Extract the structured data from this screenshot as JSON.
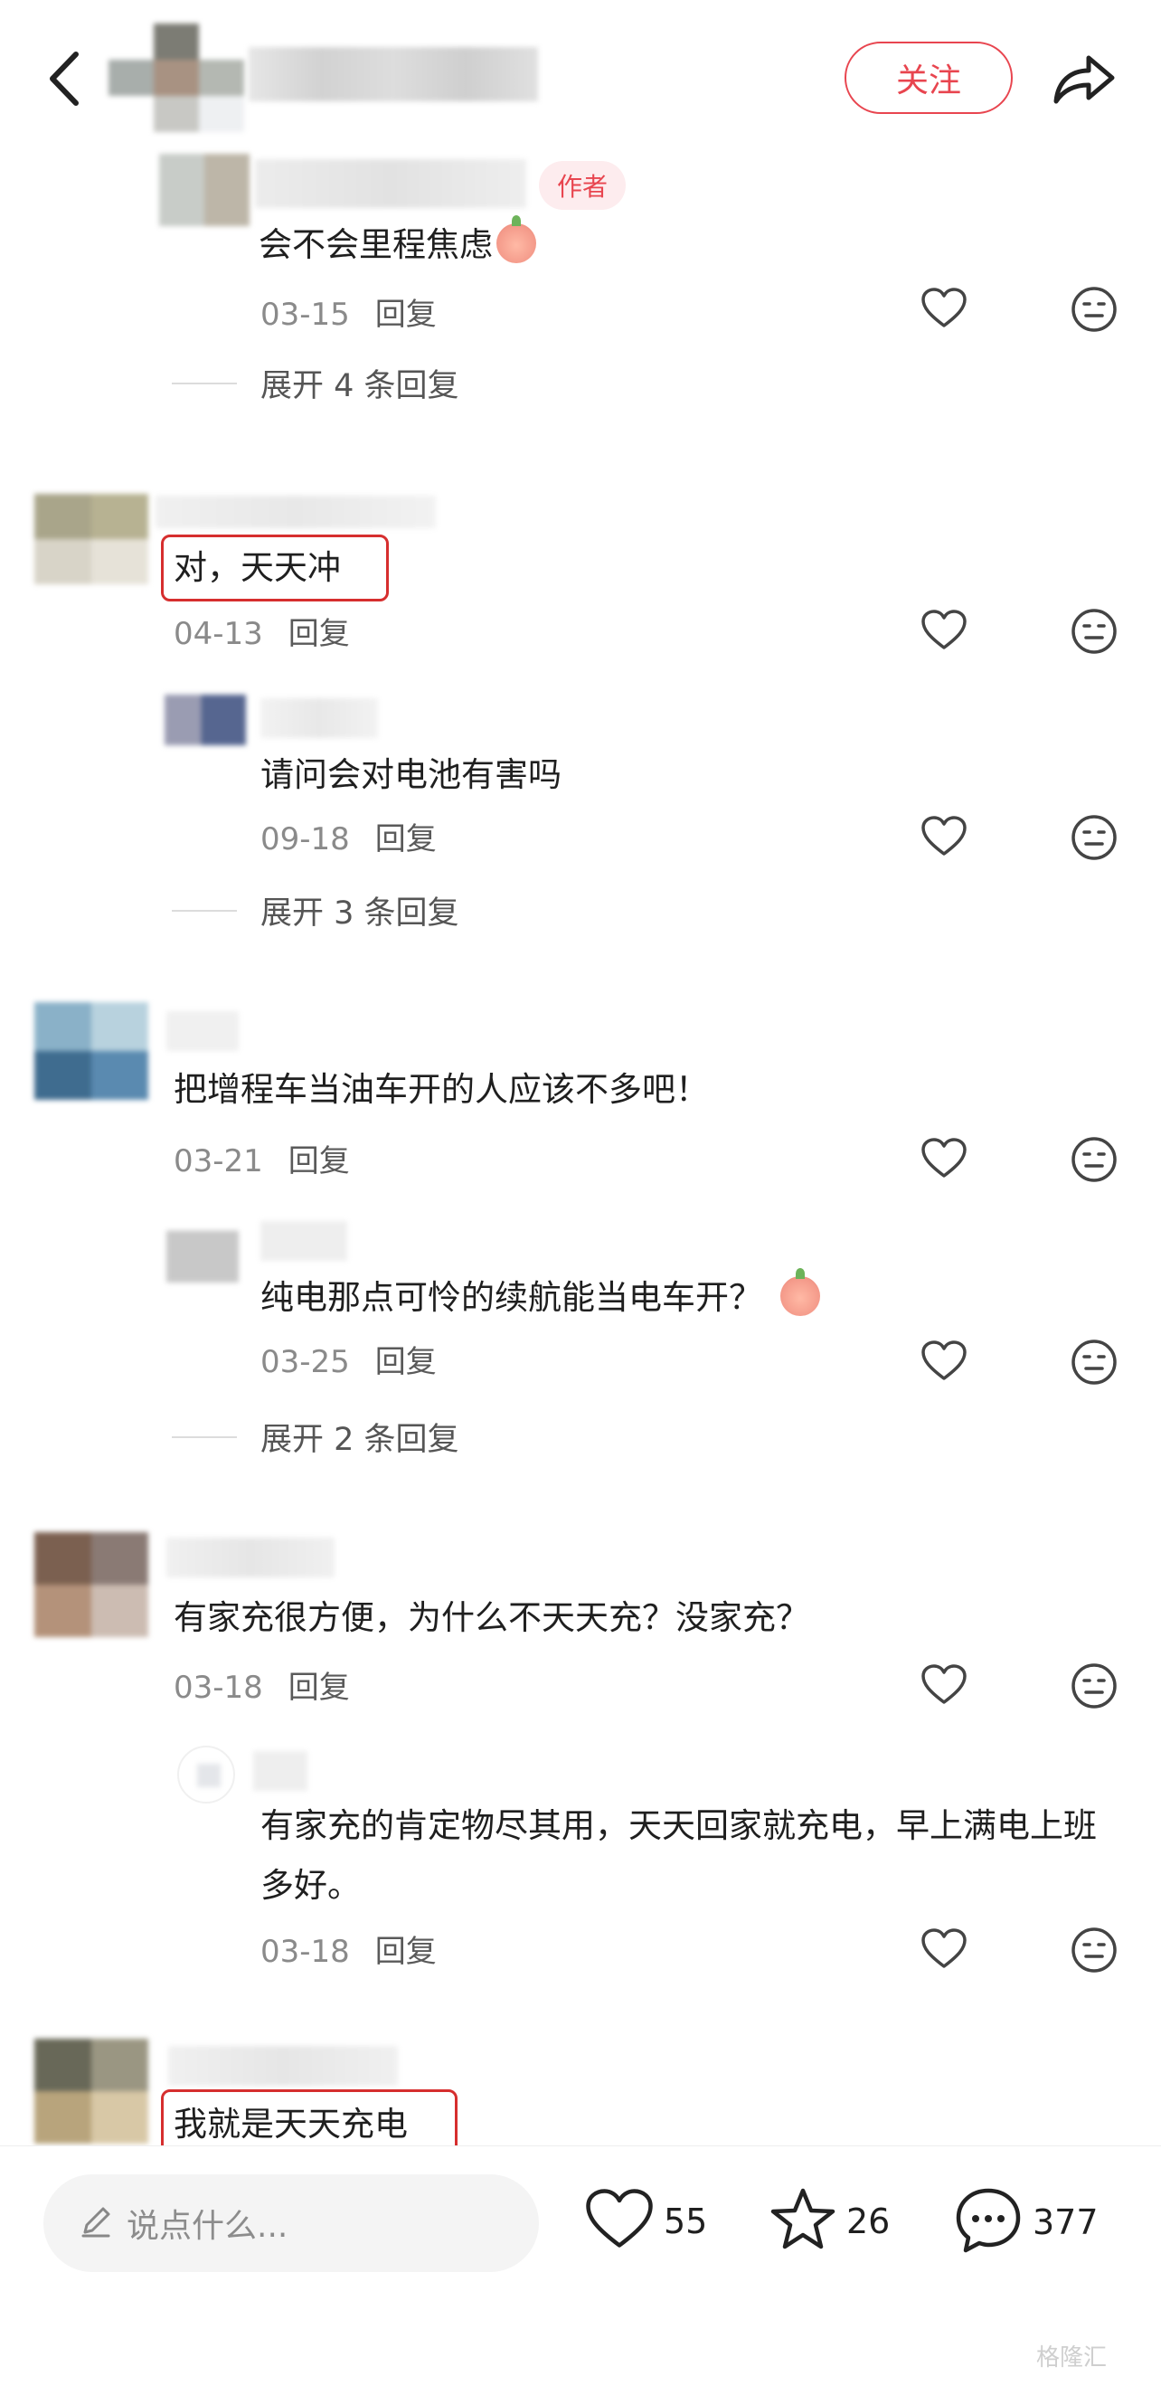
{
  "header": {
    "follow_label": "关注"
  },
  "comments": [
    {
      "author_tag": "作者",
      "text": "会不会里程焦虑",
      "date": "03-15",
      "reply": "回复",
      "expand": "展开 4 条回复"
    },
    {
      "text": "对，天天冲",
      "date": "04-13",
      "reply": "回复",
      "subreply": {
        "text": "请问会对电池有害吗",
        "date": "09-18",
        "reply": "回复"
      },
      "expand": "展开 3 条回复"
    },
    {
      "text": "把增程车当油车开的人应该不多吧！",
      "date": "03-21",
      "reply": "回复",
      "subreply": {
        "text": "纯电那点可怜的续航能当电车开？",
        "date": "03-25",
        "reply": "回复"
      },
      "expand": "展开 2 条回复"
    },
    {
      "text": "有家充很方便，为什么不天天充？没家充？",
      "date": "03-18",
      "reply": "回复",
      "subreply": {
        "text": "有家充的肯定物尽其用，天天回家就充电，早上满电上班多好。",
        "date": "03-18",
        "reply": "回复"
      }
    },
    {
      "text": "我就是天天充电"
    }
  ],
  "bottom_bar": {
    "input_placeholder": "说点什么...",
    "likes": "55",
    "stars": "26",
    "comments": "377"
  },
  "watermark": "格隆汇",
  "colors": {
    "accent": "#e8454f",
    "highlight_box": "#d62e2e",
    "meta_gray": "#8a8a8a"
  }
}
